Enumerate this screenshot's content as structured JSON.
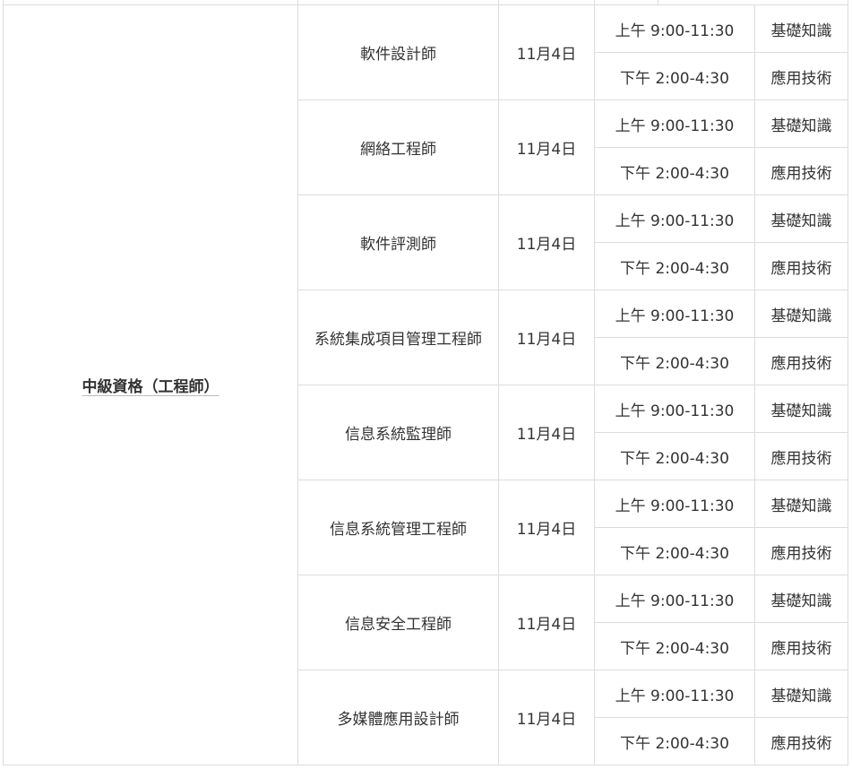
{
  "level": "中級資格（工程師）",
  "exams": [
    {
      "name": "軟件設計師",
      "date": "11月4日",
      "sessions": [
        {
          "time": "上午 9:00-11:30",
          "subject": "基礎知識"
        },
        {
          "time": "下午 2:00-4:30",
          "subject": "應用技術"
        }
      ]
    },
    {
      "name": "網絡工程師",
      "date": "11月4日",
      "sessions": [
        {
          "time": "上午 9:00-11:30",
          "subject": "基礎知識"
        },
        {
          "time": "下午 2:00-4:30",
          "subject": "應用技術"
        }
      ]
    },
    {
      "name": "軟件評測師",
      "date": "11月4日",
      "sessions": [
        {
          "time": "上午 9:00-11:30",
          "subject": "基礎知識"
        },
        {
          "time": "下午 2:00-4:30",
          "subject": "應用技術"
        }
      ]
    },
    {
      "name": "系統集成項目管理工程師",
      "date": "11月4日",
      "sessions": [
        {
          "time": "上午 9:00-11:30",
          "subject": "基礎知識"
        },
        {
          "time": "下午 2:00-4:30",
          "subject": "應用技術"
        }
      ]
    },
    {
      "name": "信息系統監理師",
      "date": "11月4日",
      "sessions": [
        {
          "time": "上午 9:00-11:30",
          "subject": "基礎知識"
        },
        {
          "time": "下午 2:00-4:30",
          "subject": "應用技術"
        }
      ]
    },
    {
      "name": "信息系統管理工程師",
      "date": "11月4日",
      "sessions": [
        {
          "time": "上午 9:00-11:30",
          "subject": "基礎知識"
        },
        {
          "time": "下午 2:00-4:30",
          "subject": "應用技術"
        }
      ]
    },
    {
      "name": "信息安全工程師",
      "date": "11月4日",
      "sessions": [
        {
          "time": "上午 9:00-11:30",
          "subject": "基礎知識"
        },
        {
          "time": "下午 2:00-4:30",
          "subject": "應用技術"
        }
      ]
    },
    {
      "name": "多媒體應用設計師",
      "date": "11月4日",
      "sessions": [
        {
          "time": "上午 9:00-11:30",
          "subject": "基礎知識"
        },
        {
          "time": "下午 2:00-4:30",
          "subject": "應用技術"
        }
      ]
    }
  ]
}
